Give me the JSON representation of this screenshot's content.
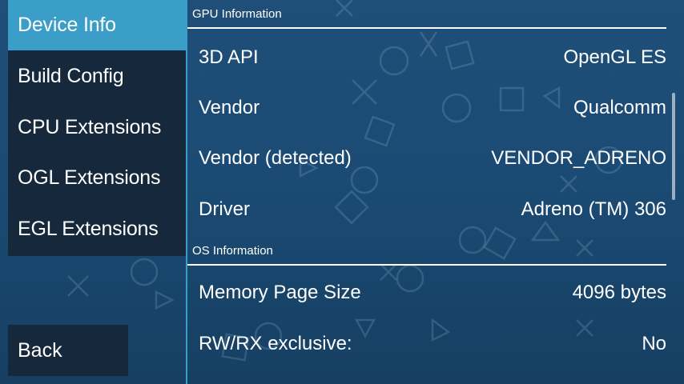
{
  "sidebar": {
    "items": [
      {
        "label": "Device Info",
        "active": true
      },
      {
        "label": "Build Config",
        "active": false
      },
      {
        "label": "CPU Extensions",
        "active": false
      },
      {
        "label": "OGL Extensions",
        "active": false
      },
      {
        "label": "EGL Extensions",
        "active": false
      }
    ],
    "back_label": "Back"
  },
  "sections": {
    "gpu": {
      "header": "GPU Information",
      "rows": [
        {
          "label": "3D API",
          "value": "OpenGL ES"
        },
        {
          "label": "Vendor",
          "value": "Qualcomm"
        },
        {
          "label": "Vendor (detected)",
          "value": "VENDOR_ADRENO"
        },
        {
          "label": "Driver",
          "value": "Adreno (TM) 306"
        }
      ]
    },
    "os": {
      "header": "OS Information",
      "rows": [
        {
          "label": "Memory Page Size",
          "value": "4096 bytes"
        },
        {
          "label": "RW/RX exclusive:",
          "value": "No"
        }
      ]
    }
  },
  "colors": {
    "accent": "#3a9ec8",
    "panel": "#16283b",
    "background": "#1b4b74"
  }
}
